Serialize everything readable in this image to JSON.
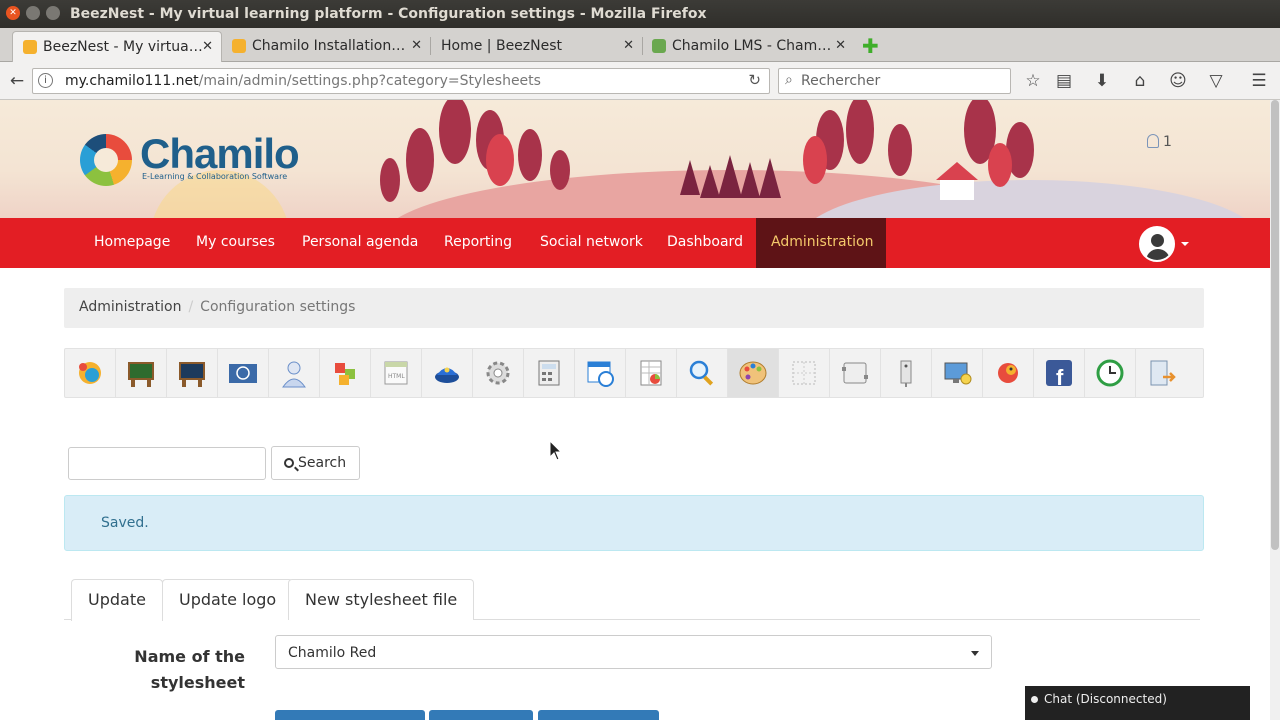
{
  "window": {
    "title": "BeezNest - My virtual learning platform - Configuration settings - Mozilla Firefox"
  },
  "browser": {
    "tabs": [
      {
        "label": "BeezNest - My virtua…",
        "active": true
      },
      {
        "label": "Chamilo Installation…",
        "active": false
      },
      {
        "label": "Home | BeezNest",
        "active": false
      },
      {
        "label": "Chamilo LMS - Cham…",
        "active": false
      }
    ],
    "url_host": "my.chamilo111.net",
    "url_path": "/main/admin/settings.php?category=Stylesheets",
    "search_placeholder": "Rechercher",
    "new_tab": "✚"
  },
  "header": {
    "brand": "Chamilo",
    "tagline": "E-Learning & Collaboration Software",
    "online_users": "1"
  },
  "nav": {
    "items": [
      "Homepage",
      "My courses",
      "Personal agenda",
      "Reporting",
      "Social network",
      "Dashboard",
      "Administration"
    ],
    "active": "Administration"
  },
  "breadcrumb": {
    "root": "Administration",
    "separator": "/",
    "current": "Configuration settings"
  },
  "settings_icons": [
    "platform",
    "course",
    "session",
    "language",
    "user",
    "tools",
    "editor",
    "security",
    "general",
    "gradebook",
    "timezone",
    "tracking",
    "search",
    "stylesheets",
    "templates",
    "plugins",
    "ldap",
    "portfolio",
    "registration",
    "social",
    "ticket",
    "services",
    "export"
  ],
  "search": {
    "value": "",
    "button_label": "Search"
  },
  "alert": {
    "text": "Saved."
  },
  "form_tabs": [
    "Update",
    "Update logo",
    "New stylesheet file"
  ],
  "form": {
    "label": "Name of the stylesheet",
    "selected": "Chamilo Red"
  },
  "chat": {
    "label": "Chat (Disconnected)"
  },
  "colors": {
    "nav_red": "#e31e24",
    "nav_active_bg": "#5e1316",
    "nav_active_text": "#f4c96b",
    "alert_bg": "#d9edf7",
    "brand_blue": "#1f5f8b"
  }
}
